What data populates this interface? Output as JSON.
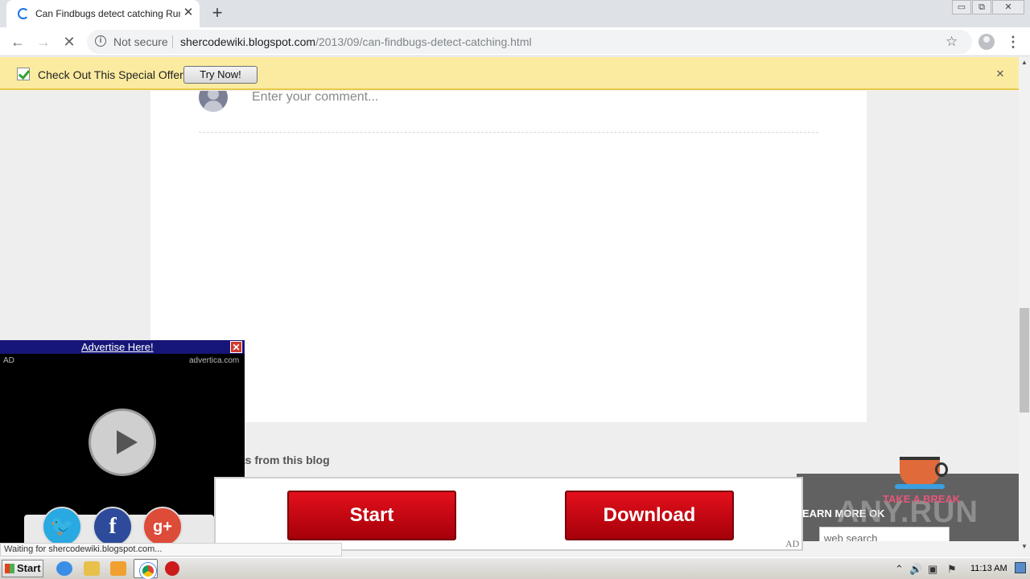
{
  "browser": {
    "tab_title": "Can Findbugs detect catching Runtime",
    "tab_close": "✕",
    "new_tab": "+",
    "security_label": "Not secure",
    "url_domain": "shercodewiki.blogspot.com",
    "url_path": "/2013/09/can-findbugs-detect-catching.html",
    "window_controls": [
      "▭",
      "⧉",
      "✕"
    ]
  },
  "infobar": {
    "message": "Check Out This Special Offer!",
    "button_label": "Try Now!",
    "close": "✕"
  },
  "page": {
    "comment_placeholder": "Enter your comment...",
    "posts_heading": "ts from this blog",
    "learn_more": "EARN MORE   OK",
    "web_search_placeholder": "web search",
    "chevron": "⌄"
  },
  "video_ad": {
    "link": "Advertise Here!",
    "close": "✕",
    "ad_label": "AD",
    "source": "advertica.com"
  },
  "social": {
    "twitter": "🐦",
    "facebook": "f",
    "google": "g+"
  },
  "bottom_ad": {
    "start_label": "Start",
    "download_label": "Download",
    "ad_tag": "AD"
  },
  "widgets": {
    "break_label": "TAKE A BREAK",
    "watermark": "ANY.RUN"
  },
  "status_text": "Waiting for shercodewiki.blogspot.com...",
  "taskbar": {
    "start_label": "Start",
    "clock": "11:13 AM"
  },
  "icons": {
    "back": "←",
    "forward": "→",
    "stop": "✕",
    "star": "☆",
    "menu": "⋮",
    "info": "i",
    "scroll_up": "▲",
    "scroll_down": "▼"
  }
}
